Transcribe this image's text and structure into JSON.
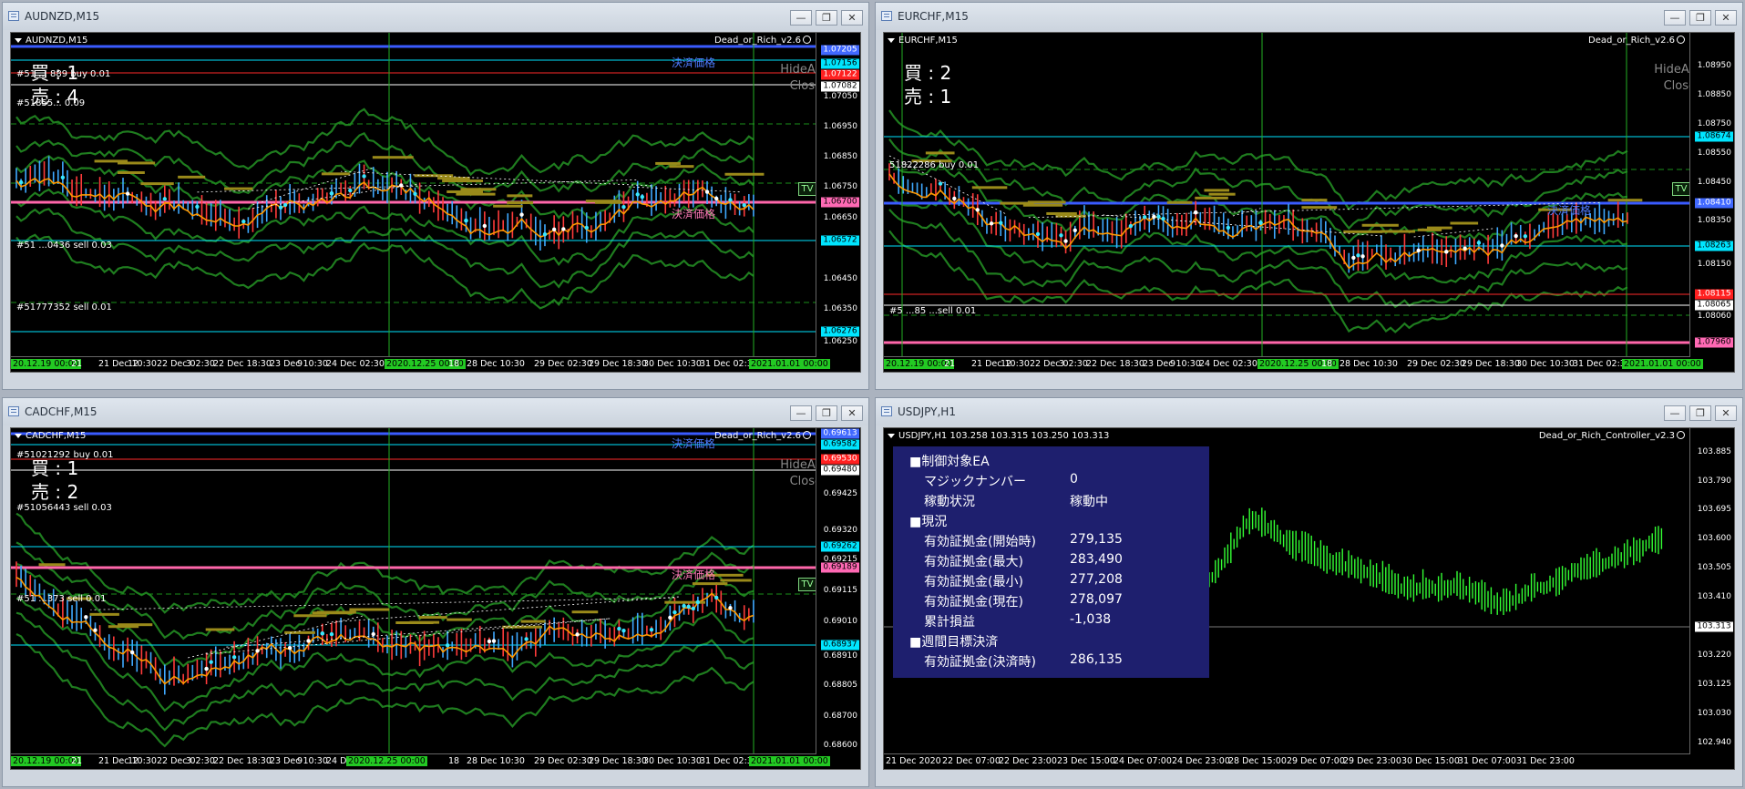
{
  "windows": {
    "w1": {
      "title": "AUDNZD,M15",
      "header": "AUDNZD,M15",
      "ea": "Dead_or_Rich_v2.6",
      "buy": "買 : 1",
      "sell": "売 : 4",
      "hide": "HideAll",
      "close": "Close",
      "tv": "TV",
      "settle_label": "決済価格",
      "orders": [
        "#51 ... 889 buy 0.01",
        "#51855... 0.09",
        "#51 ...0436 sell 0.03",
        "#51777352 sell 0.01"
      ],
      "prices": [
        "1.07205",
        "1.07156",
        "1.07122",
        "1.07082",
        "1.07050",
        "1.06950",
        "1.06850",
        "1.06750",
        "1.06700",
        "1.06650",
        "1.06572",
        "1.06450",
        "1.06350",
        "1.06276",
        "1.06250"
      ],
      "times": [
        "21",
        "21 Dec 10:30",
        "12",
        "22 Dec 02:30",
        "3",
        "22 Dec 18:30",
        "23 Dec 10:30",
        "18",
        "9",
        "24 Dec 02:30",
        "0",
        "18",
        "28 Dec 10:30",
        "9",
        "29 Dec 02:30",
        "0",
        "29 Dec 18:30",
        "15",
        "30 Dec 10:30",
        "6",
        "31 Dec 02:30",
        "21"
      ],
      "tag_start": "20.12.19 00:00",
      "tag_mid": "2020.12.25 00:00",
      "tag_end": "2021.01.01 00:00"
    },
    "w2": {
      "title": "EURCHF,M15",
      "header": "EURCHF,M15",
      "ea": "Dead_or_Rich_v2.6",
      "buy": "買 : 2",
      "sell": "売 : 1",
      "hide": "HideAll",
      "close": "Close",
      "tv": "TV",
      "settle_label": "決済価格",
      "orders": [
        "51822286 buy 0.01",
        "#5 ...85 ...sell 0.01"
      ],
      "prices": [
        "1.08950",
        "1.08850",
        "1.08750",
        "1.08674",
        "1.08550",
        "1.08450",
        "1.08410",
        "1.08350",
        "1.08263",
        "1.08150",
        "1.08115",
        "1.08065",
        "1.08060",
        "1.07960"
      ],
      "times": [
        "21",
        "21 Dec 10:30",
        "12",
        "22 Dec 02:30",
        "3",
        "22 Dec 18:30",
        "23 Dec 10:30",
        "18",
        "9",
        "24 Dec 02:30",
        "0",
        "18",
        "28 Dec 10:30",
        "9",
        "29 Dec 02:30",
        "0",
        "29 Dec 18:30",
        "15",
        "30 Dec 10:30",
        "6",
        "31 Dec 02:30",
        "21"
      ],
      "tag_start": "20.12.19 00:00",
      "tag_mid": "2020.12.25 00:00",
      "tag_end": "2021.01.01 00:00"
    },
    "w3": {
      "title": "CADCHF,M15",
      "header": "CADCHF,M15",
      "ea": "Dead_or_Rich_v2.6",
      "buy": "買 : 1",
      "sell": "売 : 2",
      "hide": "HideAll",
      "close": "Close",
      "tv": "TV",
      "settle_label": "決済価格",
      "orders": [
        "#51021292 buy 0.01",
        "#51056443 sell 0.03",
        "#51 ...373 sell 0.01"
      ],
      "prices": [
        "0.69613",
        "0.69582",
        "0.69530",
        "0.69480",
        "0.69425",
        "0.69320",
        "0.69262",
        "0.69215",
        "0.69189",
        "0.69115",
        "0.69010",
        "0.68937",
        "0.68910",
        "0.68805",
        "0.68700",
        "0.68600"
      ],
      "times": [
        "21",
        "21 Dec 10:30",
        "12",
        "22 Dec 02:30",
        "3",
        "22 Dec 18:30",
        "23 Dec 10:30",
        "18",
        "9",
        "24 Dec 02:30",
        "0",
        "18",
        "28 Dec 10:30",
        "9",
        "29 Dec 02:30",
        "0",
        "29 Dec 18:30",
        "15",
        "30 Dec 10:30",
        "6",
        "31 Dec 02:30",
        "21"
      ],
      "tag_start": "20.12.19 00:00",
      "tag_mid": "2020.12.25 00:00",
      "tag_end": "2021.01.01 00:00"
    },
    "w4": {
      "title": "USDJPY,H1",
      "header": "USDJPY,H1  103.258 103.315 103.250 103.313",
      "ea": "Dead_or_Rich_Controller_v2.3",
      "prices": [
        "103.885",
        "103.790",
        "103.695",
        "103.600",
        "103.505",
        "103.410",
        "103.313",
        "103.220",
        "103.125",
        "103.030",
        "102.940"
      ],
      "times": [
        "21 Dec 2020",
        "22 Dec 07:00",
        "22 Dec 23:00",
        "23 Dec 15:00",
        "24 Dec 07:00",
        "24 Dec 23:00",
        "28 Dec 15:00",
        "29 Dec 07:00",
        "29 Dec 23:00",
        "30 Dec 15:00",
        "31 Dec 07:00",
        "31 Dec 23:00"
      ],
      "panel": {
        "h1": "■制御対象EA",
        "magic_label": "マジックナンバー",
        "magic_value": "0",
        "status_label": "稼動状況",
        "status_value": "稼動中",
        "h2": "■現況",
        "r1_label": "有効証拠金(開始時)",
        "r1_value": "279,135",
        "r2_label": "有効証拠金(最大)",
        "r2_value": "283,490",
        "r3_label": "有効証拠金(最小)",
        "r3_value": "277,208",
        "r4_label": "有効証拠金(現在)",
        "r4_value": "278,097",
        "r5_label": "累計損益",
        "r5_value": "-1,038",
        "h3": "■週間目標決済",
        "r6_label": "有効証拠金(決済時)",
        "r6_value": "286,135"
      }
    }
  },
  "window_buttons": {
    "minimize": "—",
    "restore": "❐",
    "close": "✕"
  },
  "colors": {
    "chart_bg": "#000000",
    "green_band": "#1f7d1f",
    "orange_ma": "#ff9900",
    "settle_line": "#3a5bff",
    "pink_line": "#ff66aa",
    "red_line": "#ff2a2a",
    "tag_cyan": "#00e5ff",
    "tag_red": "#ff2020",
    "tag_pink": "#ff69b4",
    "tag_blue": "#4169ff",
    "time_tag": "#23c923",
    "panel_bg": "#1e1f6e"
  }
}
